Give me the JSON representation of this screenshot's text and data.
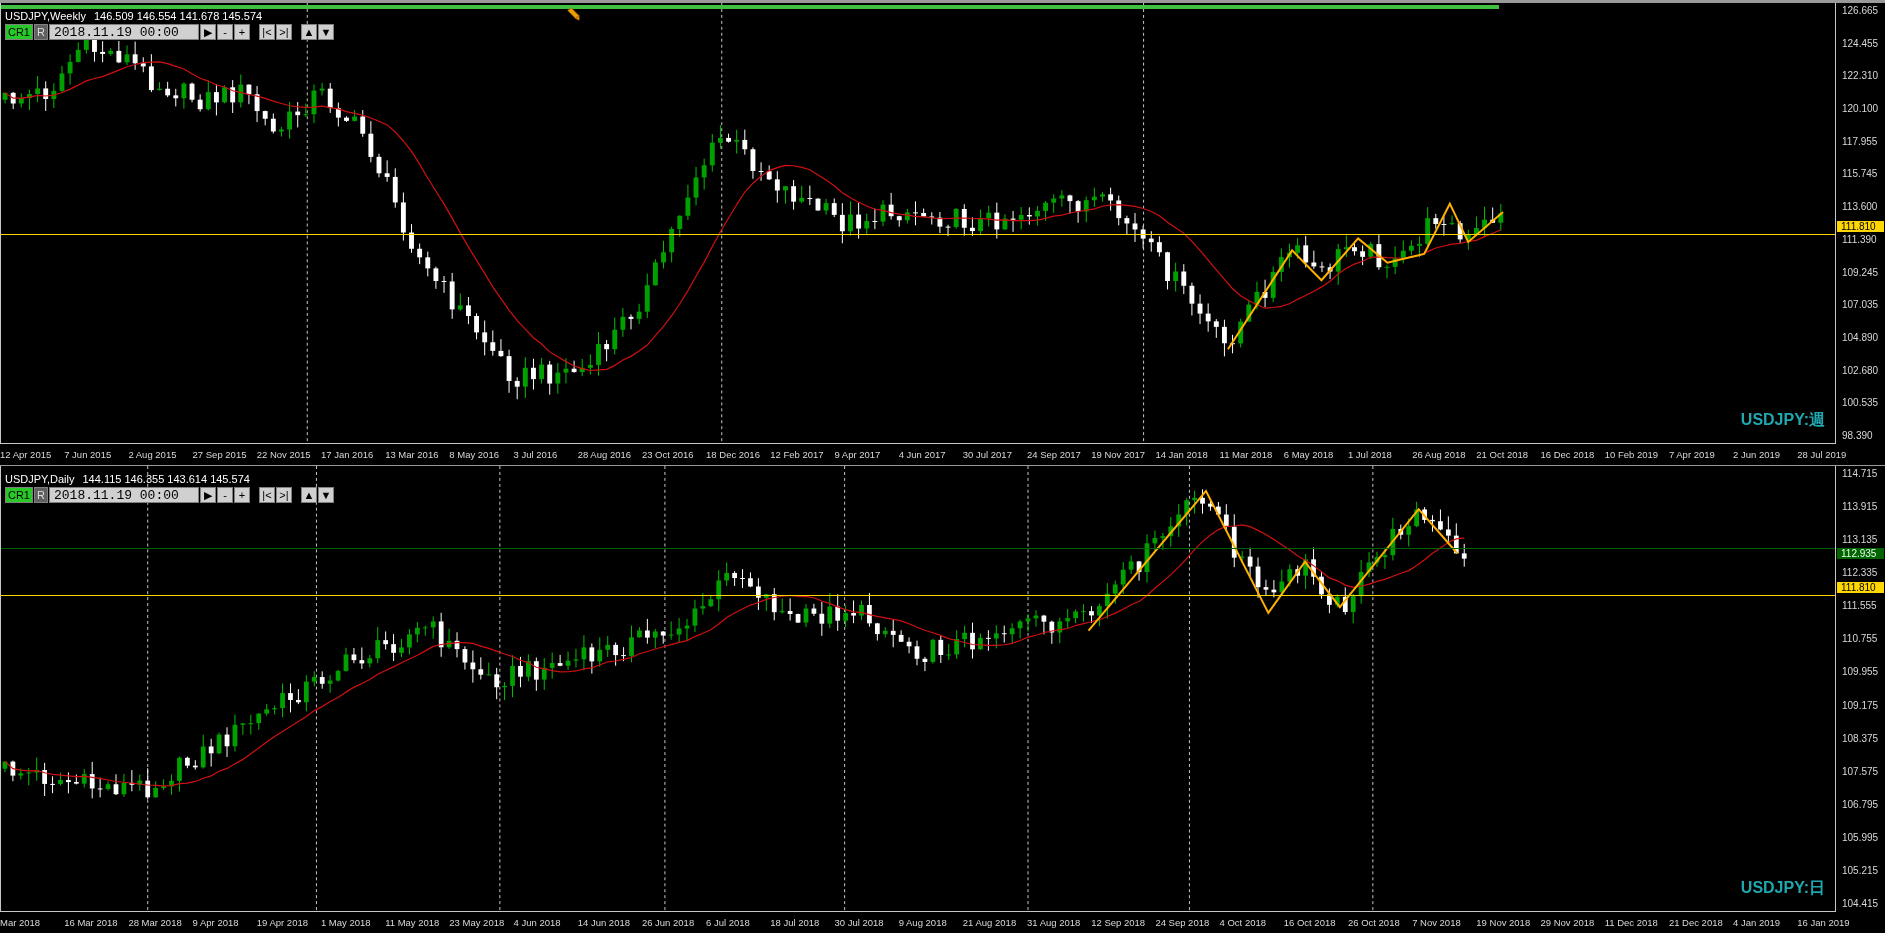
{
  "loading_bar": {
    "level": 0.817
  },
  "charts": [
    {
      "kind": "weekly",
      "title": "USDJPY,Weekly",
      "ohlc": "146.509 146.554 141.678 145.574",
      "toolbar": {
        "profile": "CR1",
        "mode": "R",
        "date": "2018.11.19 00:00",
        "button_groups": [
          [
            "▶",
            "-",
            "+"
          ],
          [
            "|<",
            ">|"
          ],
          [
            "▲",
            "▼"
          ]
        ]
      },
      "price_ticks": [
        "126.665",
        "124.455",
        "122.310",
        "120.100",
        "117.955",
        "115.745",
        "113.600",
        "111.390",
        "109.245",
        "107.035",
        "104.890",
        "102.680",
        "100.535",
        "98.390"
      ],
      "price_lines": [
        {
          "text": "111.810",
          "color": "#ffd700"
        }
      ],
      "date_ticks": [
        "12 Apr 2015",
        "7 Jun 2015",
        "2 Aug 2015",
        "27 Sep 2015",
        "22 Nov 2015",
        "17 Jan 2016",
        "13 Mar 2016",
        "8 May 2016",
        "3 Jul 2016",
        "28 Aug 2016",
        "23 Oct 2016",
        "18 Dec 2016",
        "12 Feb 2017",
        "9 Apr 2017",
        "4 Jun 2017",
        "30 Jul 2017",
        "24 Sep 2017",
        "19 Nov 2017",
        "14 Jan 2018",
        "11 Mar 2018",
        "6 May 2018",
        "1 Jul 2018",
        "26 Aug 2018",
        "21 Oct 2018",
        "16 Dec 2018",
        "10 Feb 2019",
        "7 Apr 2019",
        "2 Jun 2019",
        "28 Jul 2019"
      ],
      "symbol_label": "USDJPY:週"
    },
    {
      "kind": "daily",
      "title": "USDJPY,Daily",
      "ohlc": "144.115 146.355 143.614 145.574",
      "toolbar": {
        "profile": "CR1",
        "mode": "R",
        "date": "2018.11.19 00:00",
        "button_groups": [
          [
            "▶",
            "-",
            "+"
          ],
          [
            "|<",
            ">|"
          ],
          [
            "▲",
            "▼"
          ]
        ]
      },
      "price_ticks": [
        "114.715",
        "113.915",
        "113.135",
        "112.335",
        "111.555",
        "110.755",
        "109.955",
        "109.175",
        "108.375",
        "107.575",
        "106.795",
        "105.995",
        "105.215",
        "104.415"
      ],
      "price_lines": [
        {
          "text": "112.935",
          "color": "#006400"
        },
        {
          "text": "111.810",
          "color": "#ffd700"
        }
      ],
      "date_ticks": [
        "Mar 2018",
        "16 Mar 2018",
        "28 Mar 2018",
        "9 Apr 2018",
        "19 Apr 2018",
        "1 May 2018",
        "11 May 2018",
        "23 May 2018",
        "4 Jun 2018",
        "14 Jun 2018",
        "26 Jun 2018",
        "6 Jul 2018",
        "18 Jul 2018",
        "30 Jul 2018",
        "9 Aug 2018",
        "21 Aug 2018",
        "31 Aug 2018",
        "12 Sep 2018",
        "24 Sep 2018",
        "4 Oct 2018",
        "16 Oct 2018",
        "26 Oct 2018",
        "7 Nov 2018",
        "19 Nov 2018",
        "29 Nov 2018",
        "11 Dec 2018",
        "21 Dec 2018",
        "4 Jan 2019",
        "16 Jan 2019"
      ],
      "symbol_label": "USDJPY:日"
    }
  ]
}
